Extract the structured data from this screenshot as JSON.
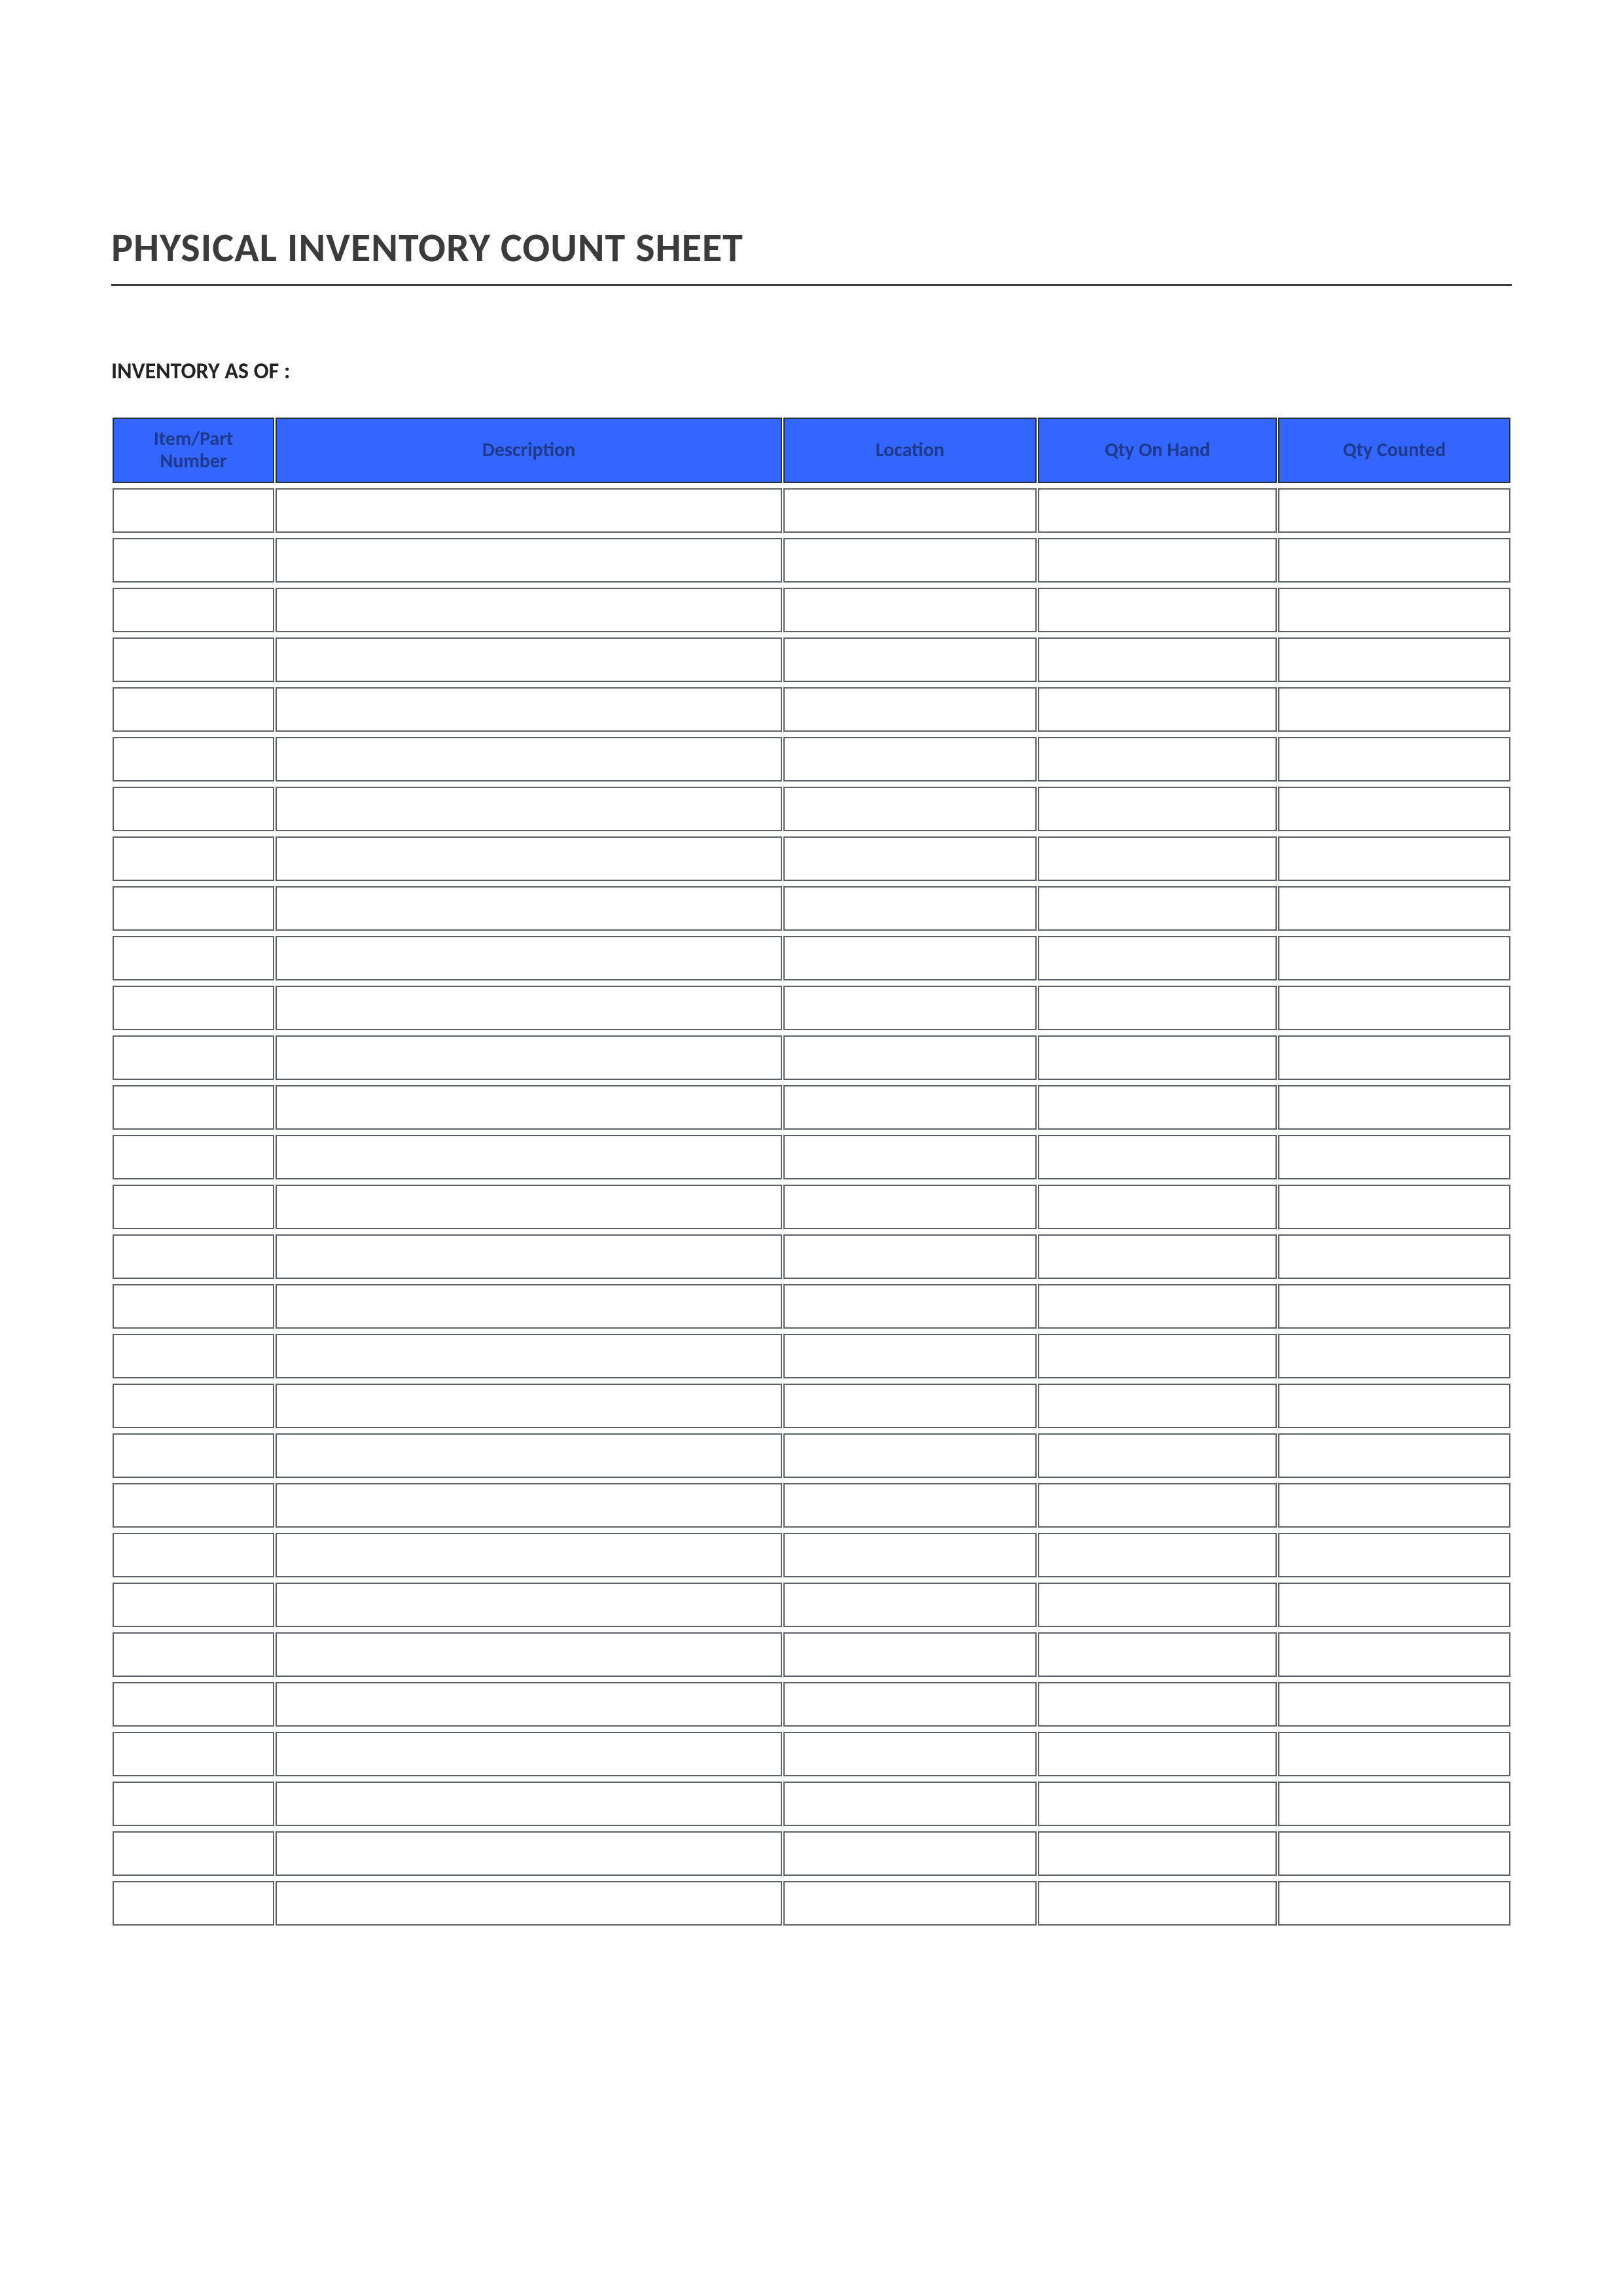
{
  "title": "PHYSICAL INVENTORY COUNT SHEET",
  "subheading": "INVENTORY AS OF :",
  "columns": {
    "item": "Item/Part Number",
    "description": "Description",
    "location": "Location",
    "qty_on_hand": "Qty On Hand",
    "qty_counted": "Qty Counted"
  },
  "row_count": 29,
  "rows": [
    {
      "item": "",
      "description": "",
      "location": "",
      "qty_on_hand": "",
      "qty_counted": ""
    },
    {
      "item": "",
      "description": "",
      "location": "",
      "qty_on_hand": "",
      "qty_counted": ""
    },
    {
      "item": "",
      "description": "",
      "location": "",
      "qty_on_hand": "",
      "qty_counted": ""
    },
    {
      "item": "",
      "description": "",
      "location": "",
      "qty_on_hand": "",
      "qty_counted": ""
    },
    {
      "item": "",
      "description": "",
      "location": "",
      "qty_on_hand": "",
      "qty_counted": ""
    },
    {
      "item": "",
      "description": "",
      "location": "",
      "qty_on_hand": "",
      "qty_counted": ""
    },
    {
      "item": "",
      "description": "",
      "location": "",
      "qty_on_hand": "",
      "qty_counted": ""
    },
    {
      "item": "",
      "description": "",
      "location": "",
      "qty_on_hand": "",
      "qty_counted": ""
    },
    {
      "item": "",
      "description": "",
      "location": "",
      "qty_on_hand": "",
      "qty_counted": ""
    },
    {
      "item": "",
      "description": "",
      "location": "",
      "qty_on_hand": "",
      "qty_counted": ""
    },
    {
      "item": "",
      "description": "",
      "location": "",
      "qty_on_hand": "",
      "qty_counted": ""
    },
    {
      "item": "",
      "description": "",
      "location": "",
      "qty_on_hand": "",
      "qty_counted": ""
    },
    {
      "item": "",
      "description": "",
      "location": "",
      "qty_on_hand": "",
      "qty_counted": ""
    },
    {
      "item": "",
      "description": "",
      "location": "",
      "qty_on_hand": "",
      "qty_counted": ""
    },
    {
      "item": "",
      "description": "",
      "location": "",
      "qty_on_hand": "",
      "qty_counted": ""
    },
    {
      "item": "",
      "description": "",
      "location": "",
      "qty_on_hand": "",
      "qty_counted": ""
    },
    {
      "item": "",
      "description": "",
      "location": "",
      "qty_on_hand": "",
      "qty_counted": ""
    },
    {
      "item": "",
      "description": "",
      "location": "",
      "qty_on_hand": "",
      "qty_counted": ""
    },
    {
      "item": "",
      "description": "",
      "location": "",
      "qty_on_hand": "",
      "qty_counted": ""
    },
    {
      "item": "",
      "description": "",
      "location": "",
      "qty_on_hand": "",
      "qty_counted": ""
    },
    {
      "item": "",
      "description": "",
      "location": "",
      "qty_on_hand": "",
      "qty_counted": ""
    },
    {
      "item": "",
      "description": "",
      "location": "",
      "qty_on_hand": "",
      "qty_counted": ""
    },
    {
      "item": "",
      "description": "",
      "location": "",
      "qty_on_hand": "",
      "qty_counted": ""
    },
    {
      "item": "",
      "description": "",
      "location": "",
      "qty_on_hand": "",
      "qty_counted": ""
    },
    {
      "item": "",
      "description": "",
      "location": "",
      "qty_on_hand": "",
      "qty_counted": ""
    },
    {
      "item": "",
      "description": "",
      "location": "",
      "qty_on_hand": "",
      "qty_counted": ""
    },
    {
      "item": "",
      "description": "",
      "location": "",
      "qty_on_hand": "",
      "qty_counted": ""
    },
    {
      "item": "",
      "description": "",
      "location": "",
      "qty_on_hand": "",
      "qty_counted": ""
    },
    {
      "item": "",
      "description": "",
      "location": "",
      "qty_on_hand": "",
      "qty_counted": ""
    }
  ]
}
